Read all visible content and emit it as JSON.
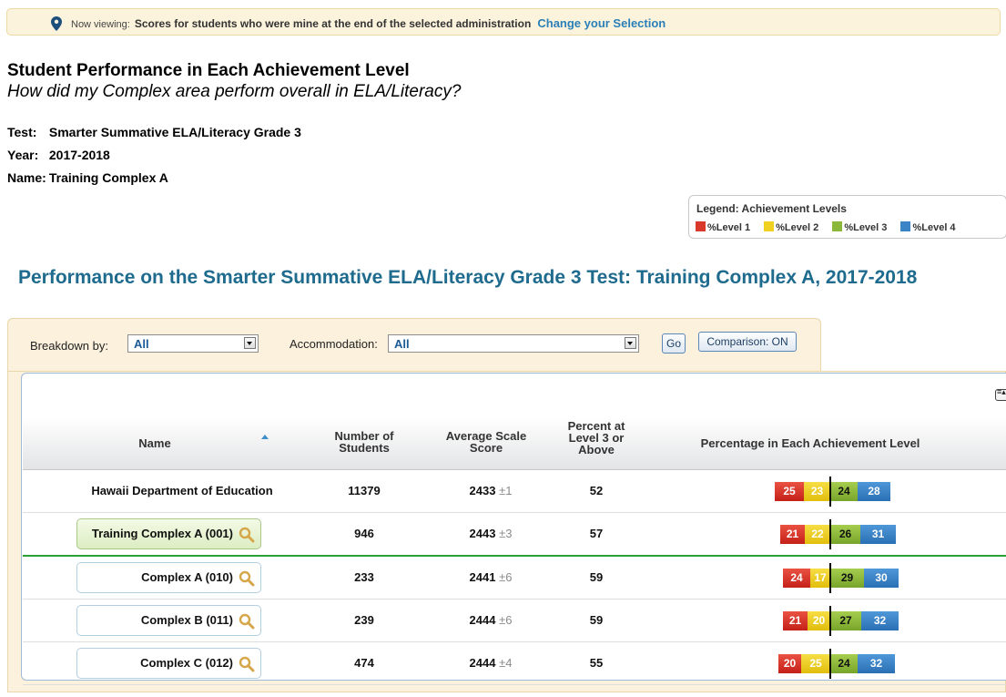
{
  "banner": {
    "now_viewing": "Now viewing:",
    "selection": "Scores for students who were mine at the end of the selected administration",
    "change_link": "Change your Selection"
  },
  "heading": {
    "title": "Student Performance in Each Achievement Level",
    "subtitle": "How did my Complex area perform overall in ELA/Literacy?"
  },
  "meta": {
    "test_label": "Test:",
    "test_value": "Smarter Summative ELA/Literacy Grade 3",
    "year_label": "Year:",
    "year_value": "2017-2018",
    "name_label": "Name:",
    "name_value": "Training Complex A"
  },
  "legend": {
    "title": "Legend: Achievement Levels",
    "items": [
      {
        "label": "%Level 1",
        "color": "#d93a2b"
      },
      {
        "label": "%Level 2",
        "color": "#f0d020"
      },
      {
        "label": "%Level 3",
        "color": "#8bb83a"
      },
      {
        "label": "%Level 4",
        "color": "#3b84c6"
      }
    ]
  },
  "performance_title": "Performance on the Smarter Summative ELA/Literacy Grade 3 Test: Training Complex A, 2017-2018",
  "filters": {
    "breakdown_label": "Breakdown by:",
    "breakdown_value": "All",
    "accommodation_label": "Accommodation:",
    "accommodation_value": "All",
    "go_label": "Go",
    "comparison_label": "Comparison: ON"
  },
  "table": {
    "headers": {
      "name": "Name",
      "students": "Number of Students",
      "avg": "Average Scale Score",
      "pct": "Percent at Level 3 or Above",
      "levels": "Percentage in Each Achievement Level"
    },
    "rows": [
      {
        "name": "Hawaii Department of Education",
        "students": "11379",
        "score": "2433",
        "pm": "±1",
        "pct": "52",
        "levels": [
          25,
          23,
          24,
          28
        ]
      },
      {
        "name": "Training Complex A (001)",
        "students": "946",
        "score": "2443",
        "pm": "±3",
        "pct": "57",
        "levels": [
          21,
          22,
          26,
          31
        ]
      },
      {
        "name": "Complex A (010)",
        "students": "233",
        "score": "2441",
        "pm": "±6",
        "pct": "59",
        "levels": [
          24,
          17,
          29,
          30
        ]
      },
      {
        "name": "Complex B (011)",
        "students": "239",
        "score": "2444",
        "pm": "±6",
        "pct": "59",
        "levels": [
          21,
          20,
          27,
          32
        ]
      },
      {
        "name": "Complex C (012)",
        "students": "474",
        "score": "2444",
        "pm": "±4",
        "pct": "55",
        "levels": [
          20,
          25,
          24,
          32
        ]
      }
    ]
  }
}
